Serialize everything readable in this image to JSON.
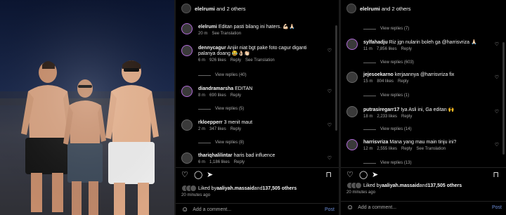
{
  "panel1": {
    "header": {
      "user": "elelrumi",
      "rest": " and 2 others"
    },
    "caption": {
      "user": "elelrumi",
      "text": "Editan pasti bilang ini haters. 💪🏻🙏🏻",
      "time": "20 m",
      "translate": "See Translation"
    },
    "comments": [
      {
        "user": "dennycagur",
        "text": "Anjiir niat bgt pake foto cagur diganti palanya doang 😂👌🏻👏🏻",
        "time": "6 m",
        "likes": "926 likes",
        "reply": "Reply",
        "translate": "See Translation",
        "view": "View replies (40)"
      },
      {
        "user": "diandramarsha",
        "text": "EDITAN",
        "time": "8 m",
        "likes": "690 likes",
        "reply": "Reply",
        "view": "View replies (5)"
      },
      {
        "user": "rkloepperr",
        "text": "3 menit maut",
        "time": "2 m",
        "likes": "347 likes",
        "reply": "Reply",
        "view": "View replies (8)"
      },
      {
        "user": "thariqhalilintar",
        "text": "haris bad influence",
        "time": "6 m",
        "likes": "1,186 likes",
        "reply": "Reply"
      }
    ],
    "liked": {
      "prefix": "Liked by ",
      "user": "aaliyah.massaid",
      "mid": " and ",
      "count": "137,505 others"
    },
    "ago": "20 minutes ago",
    "add_placeholder": "Add a comment...",
    "post": "Post"
  },
  "panel2": {
    "header": {
      "user": "elelrumi",
      "rest": " and 2 others"
    },
    "top_view": "View replies (7)",
    "comments": [
      {
        "user": "sylfahadju",
        "text": "Riz jgn nularin boleh ga @harrisvriza 🙏🏻",
        "time": "11 m",
        "likes": "7,856 likes",
        "reply": "Reply",
        "view": "View replies (603)"
      },
      {
        "user": "jejesoekarno",
        "text": "kerjaannya @harrisvriza fix",
        "time": "15 m",
        "likes": "804 likes",
        "reply": "Reply",
        "view": "View replies (1)"
      },
      {
        "user": "putrasiregarr17",
        "text": "Iya Asli ini, Ga editan 🙌",
        "time": "18 m",
        "likes": "2,233 likes",
        "reply": "Reply",
        "view": "View replies (14)"
      },
      {
        "user": "harrisvriza",
        "text": "Mana yang mau main tinju ini?",
        "time": "12 m",
        "likes": "2,555 likes",
        "reply": "Reply",
        "translate": "See Translation",
        "view": "View replies (13)"
      }
    ],
    "liked": {
      "prefix": "Liked by ",
      "user": "aaliyah.massaid",
      "mid": " and ",
      "count": "137,505 others"
    },
    "ago": "20 minutes ago",
    "add_placeholder": "Add a comment...",
    "post": "Post"
  }
}
